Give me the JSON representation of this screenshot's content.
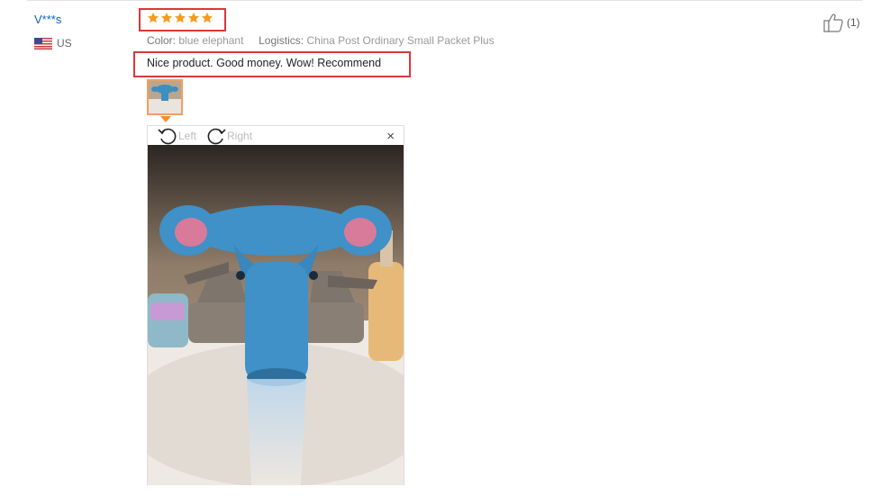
{
  "review": {
    "user_name": "V***s",
    "country": "US",
    "rating": 5,
    "rating_max": 5,
    "color_label": "Color:",
    "color_value": "blue elephant",
    "logistics_label": "Logistics:",
    "logistics_value": "China Post Ordinary Small Packet Plus",
    "text": "Nice product. Good money. Wow! Recommend",
    "helpful_count": "(1)"
  },
  "viewer": {
    "rotate_left_label": "Left",
    "rotate_right_label": "Right",
    "close_glyph": "×"
  },
  "colors": {
    "accent_star": "#f59b1e",
    "highlight_border": "#d9383a",
    "user_link": "#0a62c0",
    "thumbnail_border": "#f0a060"
  },
  "icons": [
    "us-flag-icon",
    "star-icon",
    "thumbs-up-icon",
    "rotate-left-icon",
    "rotate-right-icon",
    "close-icon"
  ]
}
